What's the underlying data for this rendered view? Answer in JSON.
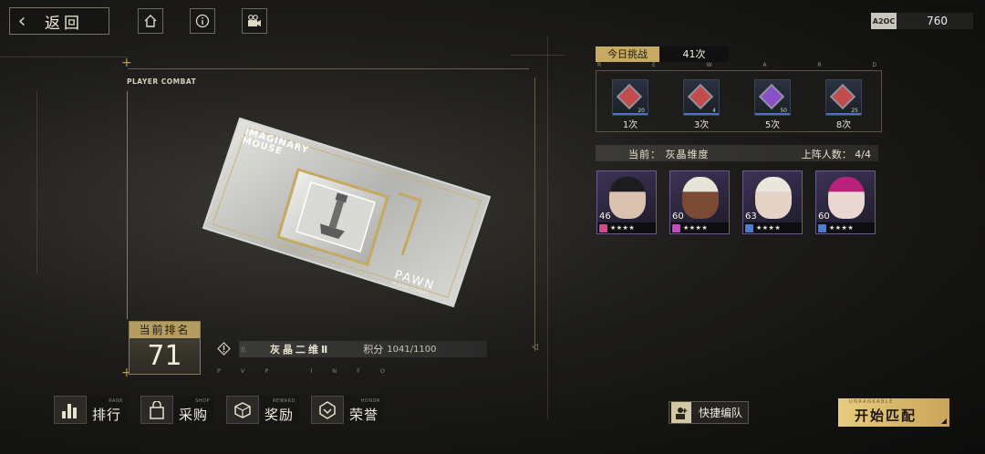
{
  "top_bar": {
    "back_label": "返回",
    "currency_chip": "A2OC",
    "currency_amount": "760"
  },
  "card": {
    "header": "PLAYER COMBAT",
    "brand_line1": "IMAGINARY",
    "brand_line2": "MOUSE",
    "piece_name": "PAWN",
    "piece_sub": "PLAYER COMBAT"
  },
  "rank": {
    "label": "当前排名",
    "value": "71"
  },
  "info": {
    "tier": "灰晶二维Ⅱ",
    "score_label": "积分",
    "score_value": "1041/1100",
    "footer": "PVP INFO"
  },
  "nav": [
    {
      "en": "RANK",
      "zh": "排行",
      "icon": "bar-chart-icon"
    },
    {
      "en": "SHOP",
      "zh": "采购",
      "icon": "shopping-bag-icon"
    },
    {
      "en": "REWARD",
      "zh": "奖励",
      "icon": "gift-box-icon"
    },
    {
      "en": "HONOR",
      "zh": "荣誉",
      "icon": "badge-icon"
    }
  ],
  "challenge": {
    "label": "今日挑战",
    "count": "41次",
    "reward_letters": [
      "R",
      "E",
      "W",
      "A",
      "R",
      "D"
    ],
    "rewards": [
      {
        "label": "1次",
        "qty": "20",
        "progress": 1.0,
        "accent": "#c24b4b"
      },
      {
        "label": "3次",
        "qty": "4",
        "progress": 1.0,
        "accent": "#c24b4b"
      },
      {
        "label": "5次",
        "qty": "50",
        "progress": 1.0,
        "accent": "#8a4fc9"
      },
      {
        "label": "8次",
        "qty": "25",
        "progress": 1.0,
        "accent": "#c24b4b"
      }
    ]
  },
  "team": {
    "current": "当前：  灰晶维度",
    "count": "上阵人数： 4/4",
    "members": [
      {
        "level": "46",
        "stars": "★★★★",
        "class_color": "#d64a8a",
        "face": "#d9c2b0",
        "hair": "#1d1d20"
      },
      {
        "level": "60",
        "stars": "★★★★",
        "class_color": "#c64ac0",
        "face": "#7a4a34",
        "hair": "#e9e4d8"
      },
      {
        "level": "63",
        "stars": "★★★★",
        "class_color": "#4a7cd6",
        "face": "#e4d4c6",
        "hair": "#eae6dc"
      },
      {
        "level": "60",
        "stars": "★★★★",
        "class_color": "#4a7cd6",
        "face": "#ead7d2",
        "hair": "#b8227c"
      }
    ]
  },
  "actions": {
    "quick_team": "快捷编队",
    "start_en": "UNRANKABLE",
    "start_zh": "开始匹配"
  },
  "colors": {
    "gold": "#c9aa62",
    "frame": "#8d7b55"
  }
}
